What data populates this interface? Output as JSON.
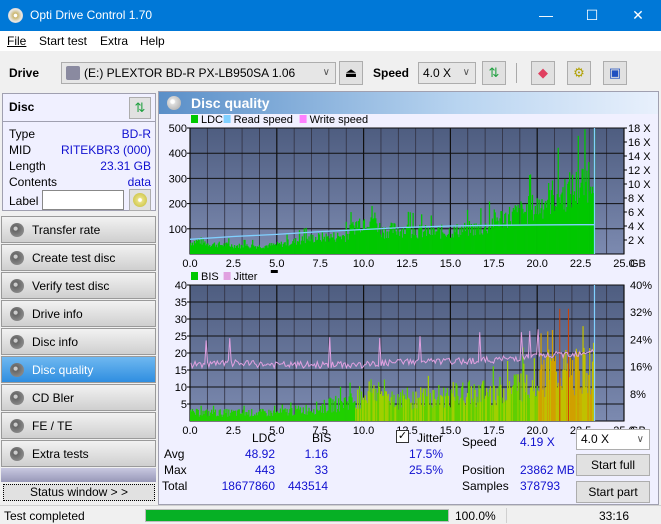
{
  "window": {
    "title": "Opti Drive Control 1.70",
    "minimize": "—",
    "maximize": "☐",
    "close": "✕"
  },
  "menu": [
    "File",
    "Start test",
    "Extra",
    "Help"
  ],
  "toolbar": {
    "drive_label": "Drive",
    "drive_value": "(E:)  PLEXTOR BD-R  PX-LB950SA 1.06",
    "speed_label": "Speed",
    "speed_value": "4.0 X"
  },
  "disc": {
    "header": "Disc",
    "fields": [
      {
        "label": "Type",
        "value": "BD-R"
      },
      {
        "label": "MID",
        "value": "RITEKBR3 (000)"
      },
      {
        "label": "Length",
        "value": "23.31 GB"
      },
      {
        "label": "Contents",
        "value": "data"
      }
    ],
    "label_field_label": "Label",
    "label_value": ""
  },
  "nav": [
    {
      "label": "Transfer rate",
      "active": false
    },
    {
      "label": "Create test disc",
      "active": false
    },
    {
      "label": "Verify test disc",
      "active": false
    },
    {
      "label": "Drive info",
      "active": false
    },
    {
      "label": "Disc info",
      "active": false
    },
    {
      "label": "Disc quality",
      "active": true
    },
    {
      "label": "CD Bler",
      "active": false
    },
    {
      "label": "FE / TE",
      "active": false
    },
    {
      "label": "Extra tests",
      "active": false
    }
  ],
  "status_window_label": "Status window > >",
  "panel_title": "Disc quality",
  "chart_data": [
    {
      "type": "area",
      "title": "LDC / Read speed",
      "legend": [
        "LDC",
        "Read speed",
        "Write speed"
      ],
      "colors": {
        "LDC": "#00c800",
        "Read speed": "#80d0ff",
        "Write speed": "#ff80ff"
      },
      "xlabel": "GB",
      "xlim": [
        0,
        25
      ],
      "xticks": [
        "0.0",
        "2.5",
        "5.0",
        "7.5",
        "10.0",
        "12.5",
        "15.0",
        "17.5",
        "20.0",
        "22.5",
        "25.0"
      ],
      "ylim": [
        0,
        500
      ],
      "yticks": [
        "100",
        "200",
        "300",
        "400",
        "500"
      ],
      "y2ticks": [
        "2 X",
        "4 X",
        "6 X",
        "8 X",
        "10 X",
        "12 X",
        "14 X",
        "16 X",
        "18 X"
      ],
      "y2lim": [
        0,
        18
      ],
      "ldc_x": [
        0,
        0.5,
        1,
        2,
        3,
        4,
        5,
        6,
        7,
        8,
        9,
        9.5,
        10,
        10.5,
        11,
        12,
        13,
        14,
        15,
        16,
        17,
        17.5,
        18,
        19,
        20,
        20.5,
        21,
        22,
        22.5,
        23,
        23.3
      ],
      "ldc_y": [
        50,
        60,
        45,
        40,
        35,
        35,
        40,
        55,
        70,
        75,
        80,
        130,
        150,
        170,
        100,
        110,
        100,
        95,
        100,
        110,
        115,
        150,
        160,
        180,
        210,
        240,
        260,
        280,
        300,
        350,
        420
      ],
      "read_speed_x": [
        0,
        2.5,
        5,
        7.5,
        10,
        12.5,
        15,
        17.5,
        20,
        22.5,
        23.3
      ],
      "read_speed_y": [
        2.1,
        2.5,
        2.8,
        3.2,
        3.5,
        3.8,
        4.0,
        4.1,
        4.15,
        4.19,
        4.19
      ]
    },
    {
      "type": "area",
      "title": "BIS / Jitter",
      "legend": [
        "BIS",
        "Jitter"
      ],
      "colors": {
        "BIS": "#00c800",
        "Jitter": "#e0a0e0"
      },
      "xlabel": "GB",
      "xlim": [
        0,
        25
      ],
      "xticks": [
        "0.0",
        "2.5",
        "5.0",
        "7.5",
        "10.0",
        "12.5",
        "15.0",
        "17.5",
        "20.0",
        "22.5",
        "25.0"
      ],
      "ylim": [
        0,
        40
      ],
      "yticks": [
        "5",
        "10",
        "15",
        "20",
        "25",
        "30",
        "35",
        "40"
      ],
      "y2ticks": [
        "8%",
        "16%",
        "24%",
        "32%",
        "40%"
      ],
      "bis_x": [
        0,
        2.5,
        5,
        7.5,
        9.5,
        10.5,
        12,
        14,
        16,
        18,
        20,
        21,
        22,
        23,
        23.3
      ],
      "bis_y": [
        3,
        3,
        3,
        5,
        8,
        12,
        8,
        9,
        10,
        11,
        17,
        18,
        18,
        19,
        20
      ],
      "jitter_x": [
        0,
        2.5,
        5,
        7.5,
        10,
        12.5,
        15,
        17.5,
        20,
        22.5,
        23.3
      ],
      "jitter_y": [
        16.5,
        17,
        16.5,
        16.5,
        16.5,
        17.5,
        17.5,
        18,
        19,
        20,
        21
      ]
    }
  ],
  "stats": {
    "col_ldc": "LDC",
    "col_bis": "BIS",
    "jitter_label": "Jitter",
    "jitter_checked": true,
    "rows": [
      {
        "label": "Avg",
        "ldc": "48.92",
        "bis": "1.16",
        "jitter": "17.5%"
      },
      {
        "label": "Max",
        "ldc": "443",
        "bis": "33",
        "jitter": "25.5%"
      },
      {
        "label": "Total",
        "ldc": "18677860",
        "bis": "443514",
        "jitter": ""
      }
    ],
    "speed_label": "Speed",
    "speed_value": "4.19 X",
    "position_label": "Position",
    "position_value": "23862 MB",
    "samples_label": "Samples",
    "samples_value": "378793",
    "speed_select": "4.0 X",
    "start_full": "Start full",
    "start_part": "Start part"
  },
  "statusbar": {
    "text": "Test completed",
    "progress_percent": 100,
    "progress_label": "100.0%",
    "time": "33:16"
  }
}
